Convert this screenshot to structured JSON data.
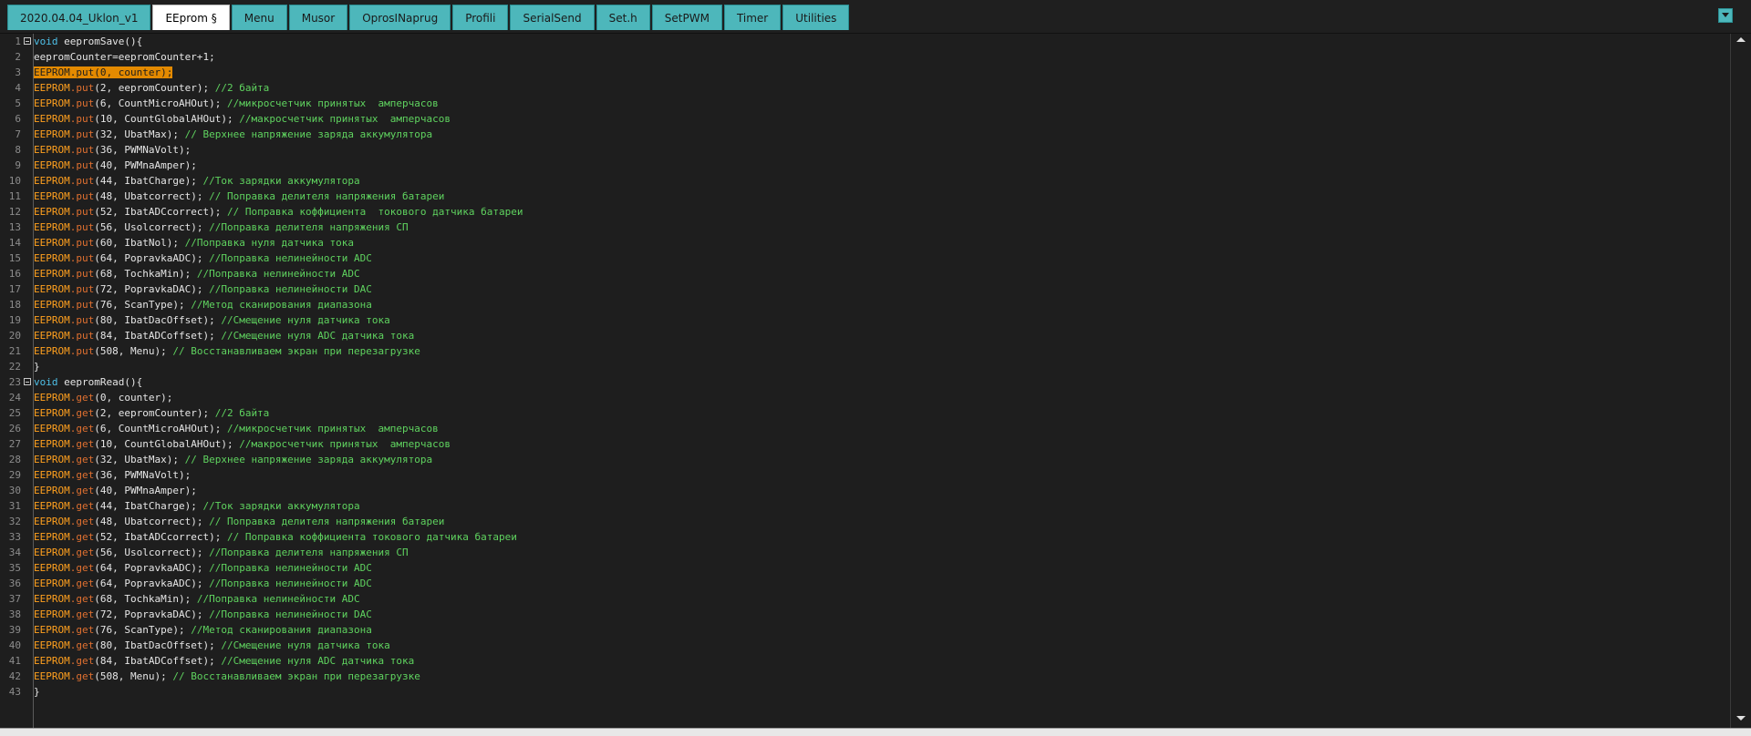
{
  "tabs": [
    {
      "label": "2020.04.04_Uklon_v1",
      "active": false
    },
    {
      "label": "EEprom §",
      "active": true
    },
    {
      "label": "Menu",
      "active": false
    },
    {
      "label": "Musor",
      "active": false
    },
    {
      "label": "OprosINaprug",
      "active": false
    },
    {
      "label": "Profili",
      "active": false
    },
    {
      "label": "SerialSend",
      "active": false
    },
    {
      "label": "Set.h",
      "active": false
    },
    {
      "label": "SetPWM",
      "active": false
    },
    {
      "label": "Timer",
      "active": false
    },
    {
      "label": "Utilities",
      "active": false
    }
  ],
  "tab_menu_icon": "dropdown-arrow-icon",
  "colors": {
    "tab": "#4db7bb",
    "tab_active": "#ffffff",
    "editor_bg": "#1e1e1e",
    "keyword": "#ffa01e",
    "comment": "#5fd35f",
    "type": "#4fc1e9",
    "highlight": "#e48a00"
  },
  "code_lines": [
    {
      "n": "1",
      "fold": true,
      "segs": [
        [
          "ty",
          "void"
        ],
        [
          "t",
          " eepromSave(){"
        ]
      ]
    },
    {
      "n": "2",
      "fold": false,
      "segs": [
        [
          "t",
          "eepromCounter=eepromCounter+"
        ],
        [
          "num",
          "1"
        ],
        [
          "t",
          ";"
        ]
      ]
    },
    {
      "n": "3",
      "fold": false,
      "segs": [
        [
          "hl",
          "EEPROM.put(0, counter);"
        ]
      ]
    },
    {
      "n": "4",
      "fold": false,
      "segs": [
        [
          "kw",
          "EEPROM"
        ],
        [
          "fn",
          ".put"
        ],
        [
          "t",
          "(2, eepromCounter); "
        ],
        [
          "cm",
          "//2 байта"
        ]
      ]
    },
    {
      "n": "5",
      "fold": false,
      "segs": [
        [
          "kw",
          "EEPROM"
        ],
        [
          "fn",
          ".put"
        ],
        [
          "t",
          "(6, CountMicroAHOut); "
        ],
        [
          "cm",
          "//микросчетчик принятых  амперчасов"
        ]
      ]
    },
    {
      "n": "6",
      "fold": false,
      "segs": [
        [
          "kw",
          "EEPROM"
        ],
        [
          "fn",
          ".put"
        ],
        [
          "t",
          "(10, CountGlobalAHOut); "
        ],
        [
          "cm",
          "//макросчетчик принятых  амперчасов"
        ]
      ]
    },
    {
      "n": "7",
      "fold": false,
      "segs": [
        [
          "kw",
          "EEPROM"
        ],
        [
          "fn",
          ".put"
        ],
        [
          "t",
          "(32, UbatMax); "
        ],
        [
          "cm",
          "// Верхнее напряжение заряда аккумулятора"
        ]
      ]
    },
    {
      "n": "8",
      "fold": false,
      "segs": [
        [
          "kw",
          "EEPROM"
        ],
        [
          "fn",
          ".put"
        ],
        [
          "t",
          "(36, PWMNaVolt);"
        ]
      ]
    },
    {
      "n": "9",
      "fold": false,
      "segs": [
        [
          "kw",
          "EEPROM"
        ],
        [
          "fn",
          ".put"
        ],
        [
          "t",
          "(40, PWMnaAmper);"
        ]
      ]
    },
    {
      "n": "10",
      "fold": false,
      "segs": [
        [
          "kw",
          "EEPROM"
        ],
        [
          "fn",
          ".put"
        ],
        [
          "t",
          "(44, IbatCharge); "
        ],
        [
          "cm",
          "//Ток зарядки аккумулятора"
        ]
      ]
    },
    {
      "n": "11",
      "fold": false,
      "segs": [
        [
          "kw",
          "EEPROM"
        ],
        [
          "fn",
          ".put"
        ],
        [
          "t",
          "(48, Ubatcorrect); "
        ],
        [
          "cm",
          "// Поправка делителя напряжения батареи"
        ]
      ]
    },
    {
      "n": "12",
      "fold": false,
      "segs": [
        [
          "kw",
          "EEPROM"
        ],
        [
          "fn",
          ".put"
        ],
        [
          "t",
          "(52, IbatADCcorrect); "
        ],
        [
          "cm",
          "// Поправка коффициента  токового датчика батареи"
        ]
      ]
    },
    {
      "n": "13",
      "fold": false,
      "segs": [
        [
          "kw",
          "EEPROM"
        ],
        [
          "fn",
          ".put"
        ],
        [
          "t",
          "(56, Usolcorrect); "
        ],
        [
          "cm",
          "//Поправка делителя напряжения СП"
        ]
      ]
    },
    {
      "n": "14",
      "fold": false,
      "segs": [
        [
          "kw",
          "EEPROM"
        ],
        [
          "fn",
          ".put"
        ],
        [
          "t",
          "(60, IbatNol); "
        ],
        [
          "cm",
          "//Поправка нуля датчика тока"
        ]
      ]
    },
    {
      "n": "15",
      "fold": false,
      "segs": [
        [
          "kw",
          "EEPROM"
        ],
        [
          "fn",
          ".put"
        ],
        [
          "t",
          "(64, PopravkaADC); "
        ],
        [
          "cm",
          "//Поправка нелинейности ADC"
        ]
      ]
    },
    {
      "n": "16",
      "fold": false,
      "segs": [
        [
          "kw",
          "EEPROM"
        ],
        [
          "fn",
          ".put"
        ],
        [
          "t",
          "(68, TochkaMin); "
        ],
        [
          "cm",
          "//Поправка нелинейности ADC"
        ]
      ]
    },
    {
      "n": "17",
      "fold": false,
      "segs": [
        [
          "kw",
          "EEPROM"
        ],
        [
          "fn",
          ".put"
        ],
        [
          "t",
          "(72, PopravkaDAC); "
        ],
        [
          "cm",
          "//Поправка нелинейности DAC"
        ]
      ]
    },
    {
      "n": "18",
      "fold": false,
      "segs": [
        [
          "kw",
          "EEPROM"
        ],
        [
          "fn",
          ".put"
        ],
        [
          "t",
          "(76, ScanType); "
        ],
        [
          "cm",
          "//Метод сканирования диапазона"
        ]
      ]
    },
    {
      "n": "19",
      "fold": false,
      "segs": [
        [
          "kw",
          "EEPROM"
        ],
        [
          "fn",
          ".put"
        ],
        [
          "t",
          "(80, IbatDacOffset); "
        ],
        [
          "cm",
          "//Смещение нуля датчика тока"
        ]
      ]
    },
    {
      "n": "20",
      "fold": false,
      "segs": [
        [
          "kw",
          "EEPROM"
        ],
        [
          "fn",
          ".put"
        ],
        [
          "t",
          "(84, IbatADCoffset); "
        ],
        [
          "cm",
          "//Смещение нуля ADC датчика тока"
        ]
      ]
    },
    {
      "n": "21",
      "fold": false,
      "segs": [
        [
          "kw",
          "EEPROM"
        ],
        [
          "fn",
          ".put"
        ],
        [
          "t",
          "(508, Menu); "
        ],
        [
          "cm",
          "// Восстанавливаем экран при перезагрузке"
        ]
      ]
    },
    {
      "n": "22",
      "fold": false,
      "segs": [
        [
          "t",
          "}"
        ]
      ]
    },
    {
      "n": "23",
      "fold": true,
      "segs": [
        [
          "ty",
          "void"
        ],
        [
          "t",
          " eepromRead(){"
        ]
      ]
    },
    {
      "n": "24",
      "fold": false,
      "segs": [
        [
          "kw",
          "EEPROM"
        ],
        [
          "fn",
          ".get"
        ],
        [
          "t",
          "(0, counter);"
        ]
      ]
    },
    {
      "n": "25",
      "fold": false,
      "segs": [
        [
          "kw",
          "EEPROM"
        ],
        [
          "fn",
          ".get"
        ],
        [
          "t",
          "(2, eepromCounter); "
        ],
        [
          "cm",
          "//2 байта"
        ]
      ]
    },
    {
      "n": "26",
      "fold": false,
      "segs": [
        [
          "kw",
          "EEPROM"
        ],
        [
          "fn",
          ".get"
        ],
        [
          "t",
          "(6, CountMicroAHOut); "
        ],
        [
          "cm",
          "//микросчетчик принятых  амперчасов"
        ]
      ]
    },
    {
      "n": "27",
      "fold": false,
      "segs": [
        [
          "kw",
          "EEPROM"
        ],
        [
          "fn",
          ".get"
        ],
        [
          "t",
          "(10, CountGlobalAHOut); "
        ],
        [
          "cm",
          "//макросчетчик принятых  амперчасов"
        ]
      ]
    },
    {
      "n": "28",
      "fold": false,
      "segs": [
        [
          "kw",
          "EEPROM"
        ],
        [
          "fn",
          ".get"
        ],
        [
          "t",
          "(32, UbatMax); "
        ],
        [
          "cm",
          "// Верхнее напряжение заряда аккумулятора"
        ]
      ]
    },
    {
      "n": "29",
      "fold": false,
      "segs": [
        [
          "kw",
          "EEPROM"
        ],
        [
          "fn",
          ".get"
        ],
        [
          "t",
          "(36, PWMNaVolt);"
        ]
      ]
    },
    {
      "n": "30",
      "fold": false,
      "segs": [
        [
          "kw",
          "EEPROM"
        ],
        [
          "fn",
          ".get"
        ],
        [
          "t",
          "(40, PWMnaAmper);"
        ]
      ]
    },
    {
      "n": "31",
      "fold": false,
      "segs": [
        [
          "kw",
          "EEPROM"
        ],
        [
          "fn",
          ".get"
        ],
        [
          "t",
          "(44, IbatCharge); "
        ],
        [
          "cm",
          "//Ток зарядки аккумулятора"
        ]
      ]
    },
    {
      "n": "32",
      "fold": false,
      "segs": [
        [
          "kw",
          "EEPROM"
        ],
        [
          "fn",
          ".get"
        ],
        [
          "t",
          "(48, Ubatcorrect); "
        ],
        [
          "cm",
          "// Поправка делителя напряжения батареи"
        ]
      ]
    },
    {
      "n": "33",
      "fold": false,
      "segs": [
        [
          "kw",
          "EEPROM"
        ],
        [
          "fn",
          ".get"
        ],
        [
          "t",
          "(52, IbatADCcorrect); "
        ],
        [
          "cm",
          "// Поправка коффициента токового датчика батареи"
        ]
      ]
    },
    {
      "n": "34",
      "fold": false,
      "segs": [
        [
          "kw",
          "EEPROM"
        ],
        [
          "fn",
          ".get"
        ],
        [
          "t",
          "(56, Usolcorrect); "
        ],
        [
          "cm",
          "//Поправка делителя напряжения СП"
        ]
      ]
    },
    {
      "n": "35",
      "fold": false,
      "segs": [
        [
          "kw",
          "EEPROM"
        ],
        [
          "fn",
          ".get"
        ],
        [
          "t",
          "(64, PopravkaADC); "
        ],
        [
          "cm",
          "//Поправка нелинейности ADC"
        ]
      ]
    },
    {
      "n": "36",
      "fold": false,
      "segs": [
        [
          "kw",
          "EEPROM"
        ],
        [
          "fn",
          ".get"
        ],
        [
          "t",
          "(64, PopravkaADC); "
        ],
        [
          "cm",
          "//Поправка нелинейности ADC"
        ]
      ]
    },
    {
      "n": "37",
      "fold": false,
      "segs": [
        [
          "kw",
          "EEPROM"
        ],
        [
          "fn",
          ".get"
        ],
        [
          "t",
          "(68, TochkaMin); "
        ],
        [
          "cm",
          "//Поправка нелинейности ADC"
        ]
      ]
    },
    {
      "n": "38",
      "fold": false,
      "segs": [
        [
          "kw",
          "EEPROM"
        ],
        [
          "fn",
          ".get"
        ],
        [
          "t",
          "(72, PopravkaDAC); "
        ],
        [
          "cm",
          "//Поправка нелинейности DAC"
        ]
      ]
    },
    {
      "n": "39",
      "fold": false,
      "segs": [
        [
          "kw",
          "EEPROM"
        ],
        [
          "fn",
          ".get"
        ],
        [
          "t",
          "(76, ScanType); "
        ],
        [
          "cm",
          "//Метод сканирования диапазона"
        ]
      ]
    },
    {
      "n": "40",
      "fold": false,
      "segs": [
        [
          "kw",
          "EEPROM"
        ],
        [
          "fn",
          ".get"
        ],
        [
          "t",
          "(80, IbatDacOffset); "
        ],
        [
          "cm",
          "//Смещение нуля датчика тока"
        ]
      ]
    },
    {
      "n": "41",
      "fold": false,
      "segs": [
        [
          "kw",
          "EEPROM"
        ],
        [
          "fn",
          ".get"
        ],
        [
          "t",
          "(84, IbatADCoffset); "
        ],
        [
          "cm",
          "//Смещение нуля ADC датчика тока"
        ]
      ]
    },
    {
      "n": "42",
      "fold": false,
      "segs": [
        [
          "kw",
          "EEPROM"
        ],
        [
          "fn",
          ".get"
        ],
        [
          "t",
          "(508, Menu); "
        ],
        [
          "cm",
          "// Восстанавливаем экран при перезагрузке"
        ]
      ]
    },
    {
      "n": "43",
      "fold": false,
      "segs": [
        [
          "t",
          "}"
        ]
      ]
    }
  ]
}
